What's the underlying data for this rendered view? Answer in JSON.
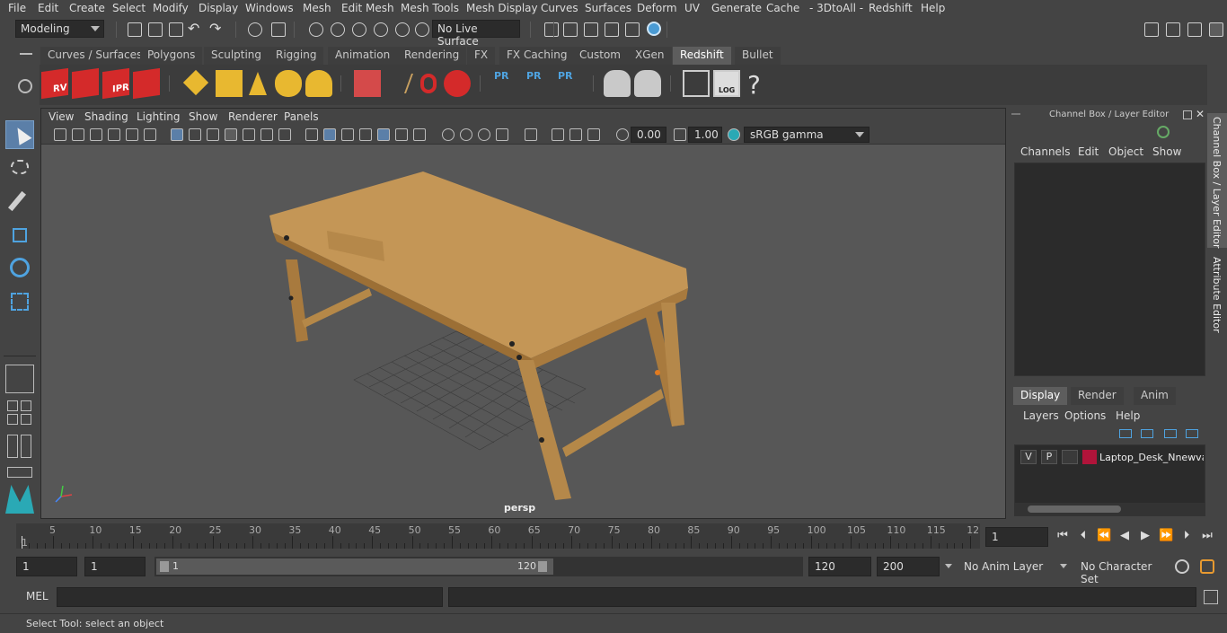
{
  "menubar": {
    "items": [
      "File",
      "Edit",
      "Create",
      "Select",
      "Modify",
      "Display",
      "Windows",
      "Mesh",
      "Edit Mesh",
      "Mesh Tools",
      "Mesh Display",
      "Curves",
      "Surfaces",
      "Deform",
      "UV",
      "Generate",
      "Cache",
      "- 3DtoAll -",
      "Redshift",
      "Help"
    ]
  },
  "statusline": {
    "mode": "Modeling",
    "live_surface": "No Live Surface"
  },
  "shelf": {
    "tabs": [
      "Curves / Surfaces",
      "Polygons",
      "Sculpting",
      "Rigging",
      "Animation",
      "Rendering",
      "FX",
      "FX Caching",
      "Custom",
      "XGen",
      "Redshift",
      "Bullet"
    ],
    "active_tab": "Redshift",
    "icon_labels": [
      "RV",
      "IPR",
      "PR",
      "PR",
      "PR",
      "LOG",
      "?"
    ]
  },
  "viewport": {
    "menus": [
      "View",
      "Shading",
      "Lighting",
      "Show",
      "Renderer",
      "Panels"
    ],
    "exposure": "0.00",
    "gamma": "1.00",
    "color_space": "sRGB gamma",
    "camera_label": "persp"
  },
  "channelbox": {
    "title": "Channel Box / Layer Editor",
    "menus": [
      "Channels",
      "Edit",
      "Object",
      "Show"
    ],
    "layer_tabs": [
      "Display",
      "Render",
      "Anim"
    ],
    "active_layer_tab": "Display",
    "layer_menus": [
      "Layers",
      "Options",
      "Help"
    ],
    "layer": {
      "v": "V",
      "p": "P",
      "name": "Laptop_Desk_Nnewvar",
      "color": "#b0143a"
    }
  },
  "side_tabs": [
    "Channel Box / Layer Editor",
    "Attribute Editor"
  ],
  "timeline": {
    "ticks": [
      "5",
      "10",
      "15",
      "20",
      "25",
      "30",
      "35",
      "40",
      "45",
      "50",
      "55",
      "60",
      "65",
      "70",
      "75",
      "80",
      "85",
      "90",
      "95",
      "100",
      "105",
      "110",
      "115",
      "12"
    ],
    "start_label": "1",
    "current_frame": "1"
  },
  "range": {
    "start": "1",
    "start2": "1",
    "slider_start": "1",
    "slider_end": "120",
    "end": "120",
    "end2": "200",
    "anim_layer": "No Anim Layer",
    "character_set": "No Character Set"
  },
  "cmdline": {
    "label": "MEL"
  },
  "helpline": {
    "text": "Select Tool: select an object"
  },
  "colors": {
    "accent": "#5d5d5d",
    "redshift_red": "#d42a2a",
    "shelf_yellow": "#e8b830",
    "wood": "#b98a4a"
  }
}
